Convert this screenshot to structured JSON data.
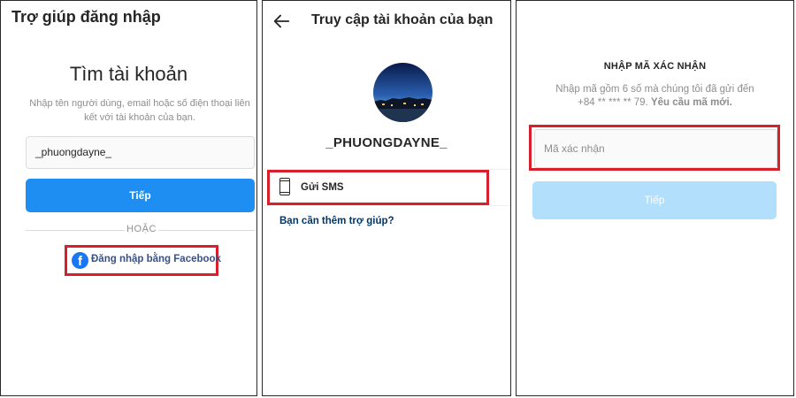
{
  "panel1": {
    "header": "Trợ giúp đăng nhập",
    "title": "Tìm tài khoản",
    "description": "Nhập tên người dùng, email hoặc số điện thoại liên kết với tài khoản của bạn.",
    "username_value": "_phuongdayne_",
    "next_button": "Tiếp",
    "or_label": "HOẶC",
    "facebook_login": "Đăng nhập bằng Facebook",
    "facebook_icon": "facebook-icon"
  },
  "panel2": {
    "header": "Truy cập tài khoản của bạn",
    "back_icon": "back-arrow-icon",
    "username": "_PHUONGDAYNE_",
    "send_sms": "Gửi SMS",
    "sms_icon": "phone-icon",
    "help_link": "Bạn cần thêm trợ giúp?"
  },
  "panel3": {
    "title": "NHẬP MÃ XÁC NHẬN",
    "description_line1": "Nhập mã gồm 6 số mà chúng tôi đã gửi đến",
    "description_phone": "+84 ** *** ** 79.",
    "resend_link": "Yêu cầu mã mới.",
    "code_placeholder": "Mã xác nhận",
    "next_button": "Tiếp"
  },
  "colors": {
    "primary_blue": "#1e8ef3",
    "disabled_blue": "#b2dffc",
    "highlight_red": "#d81f2b",
    "facebook_blue": "#1877f2",
    "link_blue": "#385185"
  }
}
